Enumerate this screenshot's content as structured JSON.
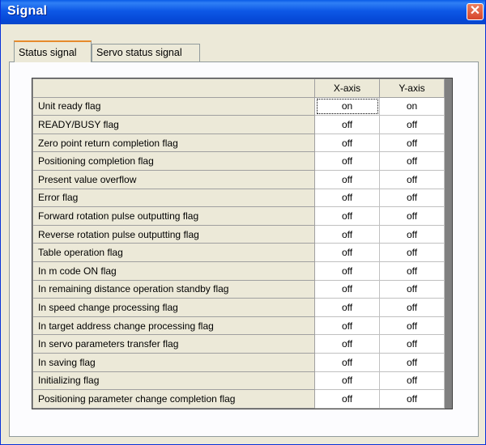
{
  "window": {
    "title": "Signal",
    "close_glyph": "✕"
  },
  "tabs": [
    {
      "label": "Status signal",
      "active": true
    },
    {
      "label": "Servo status signal",
      "active": false
    }
  ],
  "grid": {
    "columns": [
      "X-axis",
      "Y-axis"
    ],
    "rows": [
      {
        "label": "Unit ready flag",
        "x": "on",
        "y": "on"
      },
      {
        "label": "READY/BUSY flag",
        "x": "off",
        "y": "off"
      },
      {
        "label": "Zero point return completion flag",
        "x": "off",
        "y": "off"
      },
      {
        "label": "Positioning completion flag",
        "x": "off",
        "y": "off"
      },
      {
        "label": "Present value overflow",
        "x": "off",
        "y": "off"
      },
      {
        "label": "Error flag",
        "x": "off",
        "y": "off"
      },
      {
        "label": "Forward rotation pulse outputting flag",
        "x": "off",
        "y": "off"
      },
      {
        "label": "Reverse rotation pulse outputting flag",
        "x": "off",
        "y": "off"
      },
      {
        "label": "Table operation flag",
        "x": "off",
        "y": "off"
      },
      {
        "label": "In m code ON flag",
        "x": "off",
        "y": "off"
      },
      {
        "label": "In remaining distance operation standby flag",
        "x": "off",
        "y": "off"
      },
      {
        "label": "In speed change processing flag",
        "x": "off",
        "y": "off"
      },
      {
        "label": "In target address change processing flag",
        "x": "off",
        "y": "off"
      },
      {
        "label": "In servo parameters transfer flag",
        "x": "off",
        "y": "off"
      },
      {
        "label": "In saving flag",
        "x": "off",
        "y": "off"
      },
      {
        "label": "Initializing flag",
        "x": "off",
        "y": "off"
      },
      {
        "label": "Positioning parameter change completion flag",
        "x": "off",
        "y": "off"
      }
    ]
  }
}
